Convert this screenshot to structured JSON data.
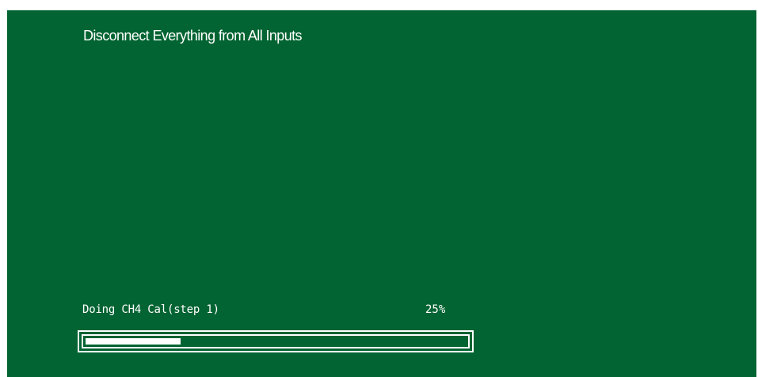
{
  "screen": {
    "instruction": "Disconnect Everything from All Inputs",
    "status_label": "Doing CH4 Cal(step 1)",
    "percent_label": "25%",
    "progress_fraction": 0.25
  },
  "colors": {
    "background": "#026432",
    "foreground": "#ffffff"
  }
}
